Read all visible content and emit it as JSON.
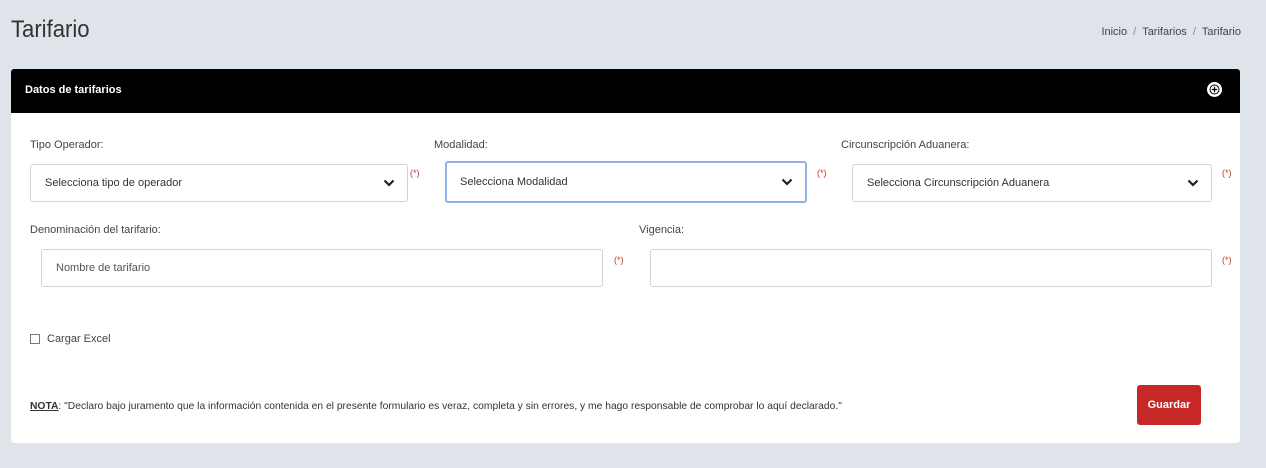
{
  "page": {
    "title": "Tarifario",
    "breadcrumb": [
      "Inicio",
      "Tarifarios",
      "Tarifario"
    ]
  },
  "card": {
    "title": "Datos de tarifarios",
    "collapse_icon": "plus-circle-icon"
  },
  "form": {
    "tipo_operador": {
      "label": "Tipo Operador:",
      "value": "Selecciona tipo de operador",
      "required": "(*)"
    },
    "modalidad": {
      "label": "Modalidad:",
      "value": "Selecciona  Modalidad",
      "required": "(*)"
    },
    "circunscripcion": {
      "label": "Circunscripción Aduanera:",
      "value": "Selecciona Circunscripción Aduanera",
      "required": "(*)"
    },
    "denominacion": {
      "label": "Denominación del tarifario:",
      "placeholder": "Nombre de tarifario",
      "required": "(*)"
    },
    "vigencia": {
      "label": "Vigencia:",
      "placeholder": "",
      "required": "(*)"
    },
    "cargar_excel": {
      "label": "Cargar Excel",
      "checked": false
    }
  },
  "note": {
    "key": "NOTA",
    "text": ": \"Declaro bajo juramento que la información contenida en el presente formulario es veraz, completa y sin errores, y me hago responsable de comprobar lo aquí declarado.\""
  },
  "actions": {
    "save_label": "Guardar"
  },
  "colors": {
    "header_bg": "#000000",
    "save_button": "#c62828",
    "required_mark": "#c0392b",
    "focus_border": "#8fb3e6"
  }
}
